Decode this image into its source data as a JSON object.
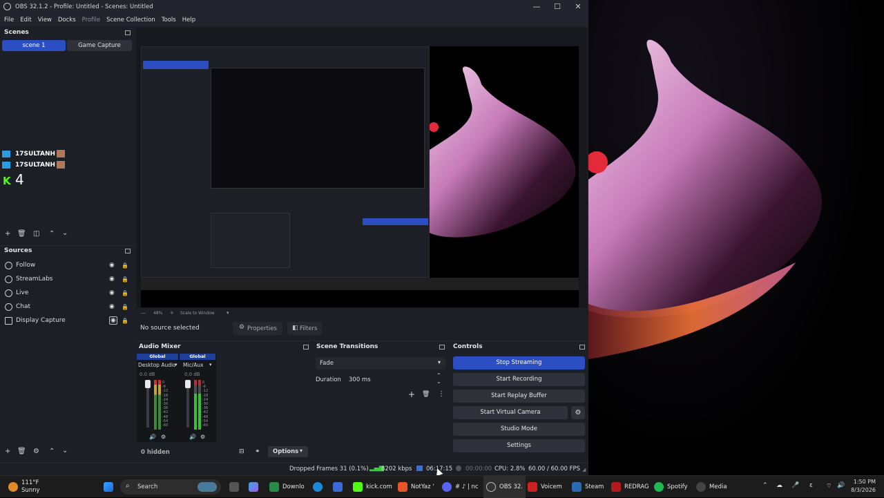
{
  "window": {
    "title": "OBS 32.1.2 - Profile: Untitled - Scenes: Untitled",
    "minimize": "—",
    "maximize": "☐",
    "close": "✕"
  },
  "menu": [
    "File",
    "Edit",
    "View",
    "Docks",
    "Profile",
    "Scene Collection",
    "Tools",
    "Help"
  ],
  "scenes": {
    "title": "Scenes",
    "items": [
      "scene 1",
      "Game Capture"
    ],
    "active": "scene 1"
  },
  "chat_overlay": {
    "lines": [
      "17SULTANH :",
      "17SULTANH :"
    ],
    "counter": "4"
  },
  "sources": {
    "title": "Sources",
    "items": [
      "Follow",
      "StreamLabs",
      "Live",
      "Chat",
      "Display Capture"
    ]
  },
  "preview": {
    "zoom": "48%",
    "scale_mode": "Scale to Window"
  },
  "source_toolbar": {
    "status": "No source selected",
    "properties": "Properties",
    "filters": "Filters"
  },
  "audio_mixer": {
    "title": "Audio Mixer",
    "channels": [
      {
        "header": "Global",
        "name": "Desktop Audio",
        "db": "0.0 dB"
      },
      {
        "header": "Global",
        "name": "Mic/Aux",
        "db": "0.0 dB"
      }
    ],
    "scale": [
      "0",
      "-6",
      "-12",
      "-18",
      "-24",
      "-30",
      "-36",
      "-42",
      "-48",
      "-54",
      "-60"
    ],
    "hidden": "0 hidden",
    "options": "Options"
  },
  "scene_transitions": {
    "title": "Scene Transitions",
    "transition": "Fade",
    "duration_label": "Duration",
    "duration_value": "300 ms"
  },
  "controls": {
    "title": "Controls",
    "buttons": [
      "Stop Streaming",
      "Start Recording",
      "Start Replay Buffer",
      "Start Virtual Camera",
      "Studio Mode",
      "Settings"
    ]
  },
  "status": {
    "dropped": "Dropped Frames 31 (0.1%)",
    "bitrate": "8202 kbps",
    "stream_time": "06:17:15",
    "rec_time": "00:00:00",
    "cpu": "CPU: 2.8%",
    "fps": "60.00 / 60.00 FPS"
  },
  "taskbar": {
    "weather_temp": "111°F",
    "weather_desc": "Sunny",
    "search": "Search",
    "apps": [
      "Downlo",
      "kick.com",
      "NotYaz '",
      "# ♪ | nc",
      "OBS 32.",
      "Voicem",
      "Steam",
      "REDRAG",
      "Spotify",
      "Media"
    ],
    "time": "1:50 PM",
    "date": "8/3/2026"
  },
  "colors": {
    "accent": "#2b4fc2",
    "panel": "#1d1f26",
    "kick_green": "#53fc18"
  }
}
